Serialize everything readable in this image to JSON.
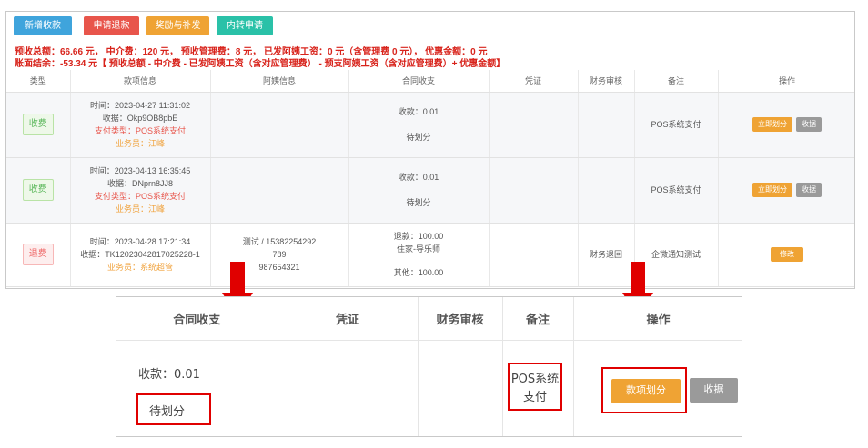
{
  "toolbar": {
    "add_payment": "新增收款",
    "apply_refund": "申请退款",
    "bonus": "奖励与补发",
    "internal_transfer": "内转申请"
  },
  "summary": {
    "line1": "预收总额：66.66 元， 中介费：120 元， 预收管理费：8 元， 已发阿姨工资：0 元（含管理费 0 元）， 优惠金额：0 元",
    "line2": "账面结余：-53.34 元【 预收总额 - 中介费 - 已发阿姨工资（含对应管理费） - 预支阿姨工资（含对应管理费）+ 优惠金额】"
  },
  "table": {
    "headers": [
      "类型",
      "款项信息",
      "阿姨信息",
      "合同收支",
      "凭证",
      "财务审核",
      "备注",
      "操作"
    ],
    "rows": [
      {
        "type": "收费",
        "time": "时间：2023-04-27 11:31:02",
        "receipt": "收据：Okp9OB8pbE",
        "pay_type": "支付类型：POS系统支付",
        "salesman": "业务员：江峰",
        "nanny": "",
        "contract_amount": "收款：0.01",
        "contract_status": "待划分",
        "finance": "",
        "remark": "POS系统支付",
        "action_primary": "立即划分",
        "action_secondary": "收据"
      },
      {
        "type": "收费",
        "time": "时间：2023-04-13 16:35:45",
        "receipt": "收据：DNprn8JJ8",
        "pay_type": "支付类型：POS系统支付",
        "salesman": "业务员：江峰",
        "nanny": "",
        "contract_amount": "收款：0.01",
        "contract_status": "待划分",
        "finance": "",
        "remark": "POS系统支付",
        "action_primary": "立即划分",
        "action_secondary": "收据"
      },
      {
        "type": "退费",
        "time": "时间：2023-04-28 17:21:34",
        "receipt": "收据：TK12023042817025228-1",
        "salesman": "业务员：系统超管",
        "nanny_line1": "测试 / 15382254292",
        "nanny_line2": "789",
        "nanny_line3": "987654321",
        "refund_amount": "退款：100.00",
        "refund_target": "住家-导乐师",
        "other_amount": "其他：100.00",
        "finance": "财务退回",
        "remark": "企微通知测试",
        "action_primary": "修改"
      }
    ]
  },
  "zoom": {
    "headers": [
      "合同收支",
      "凭证",
      "财务审核",
      "备注",
      "操作"
    ],
    "amount": "收款：0.01",
    "status": "待划分",
    "remark_line1": "POS系统",
    "remark_line2": "支付",
    "action_primary": "款项划分",
    "action_secondary": "收据"
  },
  "colors": {
    "highlight": "#e00000",
    "orange": "#efa334",
    "gray": "#9a9a9a",
    "summary_red": "#d8231b"
  }
}
